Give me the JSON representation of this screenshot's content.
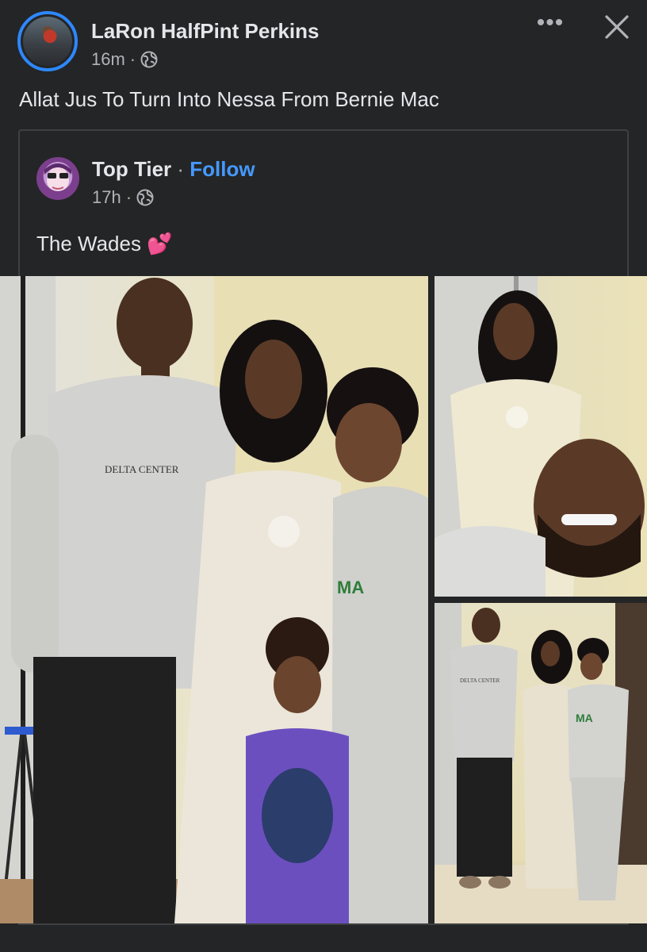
{
  "post": {
    "author_name": "LaRon HalfPint Perkins",
    "timestamp": "16m",
    "separator": "·",
    "privacy_icon": "globe-icon",
    "more_icon": "more-horizontal-icon",
    "more_label": "•••",
    "close_icon": "close-icon",
    "caption": "Allat Jus To Turn Into Nessa From Bernie Mac"
  },
  "shared_post": {
    "author_name": "Top Tier",
    "separator": "·",
    "follow_label": "Follow",
    "timestamp": "17h",
    "privacy_icon": "globe-icon",
    "text": "The Wades 💕"
  },
  "photos": {
    "count": 3,
    "main_hoodie_text": "DELTA CENTER",
    "bottom_right_hoodie_text": "DELTA CENTER"
  },
  "colors": {
    "background": "#242526",
    "text_primary": "#e4e6eb",
    "text_secondary": "#b0b3b8",
    "link_blue": "#4599ff",
    "avatar_ring": "#2d88ff",
    "divider": "#3e4042"
  }
}
